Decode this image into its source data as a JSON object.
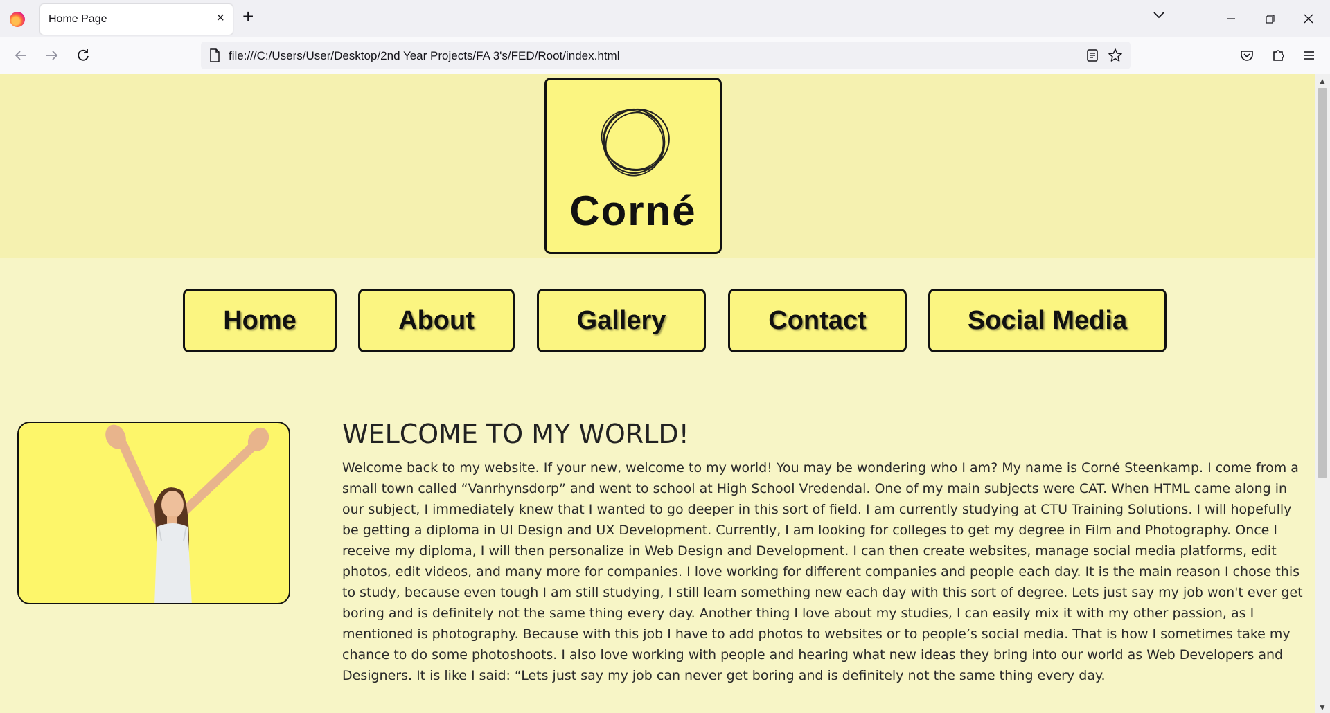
{
  "browser": {
    "tab_title": "Home Page",
    "tab_close": "×",
    "new_tab": "+",
    "url": "file:///C:/Users/User/Desktop/2nd Year Projects/FA 3's/FED/Root/index.html",
    "icons": [
      "firefox-logo-icon",
      "back-icon",
      "forward-icon",
      "reload-icon",
      "page-icon",
      "reader-view-icon",
      "bookmark-star-icon",
      "pocket-icon",
      "extensions-icon",
      "menu-icon",
      "tab-list-icon",
      "minimize-icon",
      "restore-icon",
      "close-window-icon"
    ]
  },
  "header": {
    "logo_text": "Corné"
  },
  "nav": {
    "items": [
      "Home",
      "About",
      "Gallery",
      "Contact",
      "Social Media"
    ]
  },
  "main": {
    "title": "WELCOME TO MY WORLD!",
    "body": "Welcome back to my website. If your new, welcome to my world! You may be wondering who I am? My name is Corné Steenkamp. I come from a small town called “Vanrhynsdorp” and went to school at High School Vredendal. One of my main subjects were CAT. When HTML came along in our subject, I immediately knew that I wanted to go deeper in this sort of field. I am currently studying at CTU Training Solutions. I will hopefully be getting a diploma in UI Design and UX Development. Currently, I am looking for colleges to get my degree in Film and Photography. Once I receive my diploma, I will then personalize in Web Design and Development. I can then create websites, manage social media platforms, edit photos, edit videos, and many more for companies. I love working for different companies and people each day. It is the main reason I chose this to study, because even tough I am still studying, I still learn something new each day with this sort of degree. Lets just say my job won't ever get boring and is definitely not the same thing every day. Another thing I love about my studies, I can easily mix it with my other passion, as I mentioned is photography. Because with this job I have to add photos to websites or to people’s social media. That is how I sometimes take my chance to do some photoshoots. I also love working with people and hearing what new ideas they bring into our world as Web Developers and Designers. It is like I said: “Lets just say my job can never get boring and is definitely not the same thing every day."
  },
  "colors": {
    "header_band": "#f5f1b0",
    "page_bg": "#f7f5c6",
    "button_bg": "#fbf581",
    "border": "#111111"
  }
}
